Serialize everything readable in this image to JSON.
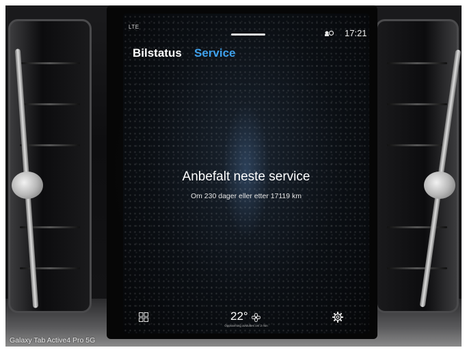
{
  "status_bar": {
    "network": "LTE",
    "time": "17:21"
  },
  "tabs": [
    {
      "label": "Bilstatus",
      "active": false
    },
    {
      "label": "Service",
      "active": true
    }
  ],
  "service": {
    "title": "Anbefalt neste service",
    "detail": "Om 230 dager eller etter 17119 km"
  },
  "bottom_bar": {
    "temperature": "22°",
    "climate_subtitle": "Oppvarming avsluttes om 2 min"
  },
  "watermark": "Galaxy Tab Active4 Pro 5G",
  "colors": {
    "accent": "#3fa2ee",
    "text": "#ffffff",
    "screen_bg": "#0b0f14"
  },
  "icons": [
    "mic-icon",
    "grid-icon",
    "fan-icon",
    "gear-icon"
  ]
}
